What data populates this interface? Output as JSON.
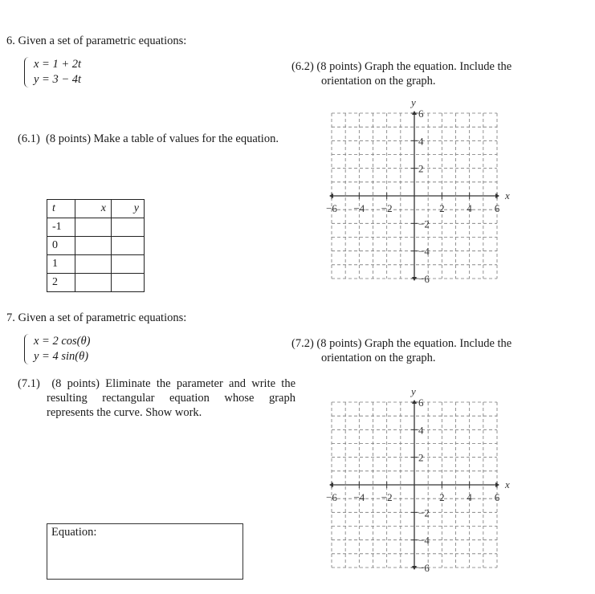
{
  "problem6": {
    "number": "6.",
    "prompt": "Given a set of parametric equations:",
    "equations": [
      "x = 1 + 2t",
      "y = 3 − 4t"
    ],
    "part1": {
      "label": "(6.1)",
      "points": "(8 points)",
      "text": "Make a table of values for the equation.",
      "table": {
        "headers": [
          "t",
          "x",
          "y"
        ],
        "rows": [
          {
            "t": "-1",
            "x": "",
            "y": ""
          },
          {
            "t": "0",
            "x": "",
            "y": ""
          },
          {
            "t": "1",
            "x": "",
            "y": ""
          },
          {
            "t": "2",
            "x": "",
            "y": ""
          }
        ]
      }
    },
    "part2": {
      "label": "(6.2)",
      "points": "(8 points)",
      "text_line1": "Graph the equation. Include the",
      "text_line2": "orientation on the graph."
    }
  },
  "problem7": {
    "number": "7.",
    "prompt": "Given a set of parametric equations:",
    "equations": [
      "x = 2 cos(θ)",
      "y = 4 sin(θ)"
    ],
    "part1": {
      "label": "(7.1)",
      "points": "(8 points)",
      "text": "Eliminate the parameter and write the resulting rectangular equation whose graph represents the curve. Show work.",
      "answer_box_label": "Equation:"
    },
    "part2": {
      "label": "(7.2)",
      "points": "(8 points)",
      "text_line1": "Graph the equation. Include the",
      "text_line2": "orientation on the graph."
    }
  },
  "chart_data": [
    {
      "type": "scatter",
      "title": "",
      "xlabel": "x",
      "ylabel": "y",
      "xlim": [
        -6,
        6
      ],
      "ylim": [
        -6,
        6
      ],
      "grid": true,
      "grid_step": 1,
      "x_tick_labels": [
        "−6",
        "−4",
        "−2",
        "2",
        "4",
        "6"
      ],
      "y_tick_labels": [
        "6",
        "4",
        "2",
        "−2",
        "−4",
        "−6"
      ],
      "x_ticks": [
        -6,
        -4,
        -2,
        2,
        4,
        6
      ],
      "y_ticks": [
        6,
        4,
        2,
        -2,
        -4,
        -6
      ],
      "series": []
    },
    {
      "type": "scatter",
      "title": "",
      "xlabel": "x",
      "ylabel": "y",
      "xlim": [
        -6,
        6
      ],
      "ylim": [
        -6,
        6
      ],
      "grid": true,
      "grid_step": 1,
      "x_tick_labels": [
        "−6",
        "−4",
        "−2",
        "2",
        "4",
        "6"
      ],
      "y_tick_labels": [
        "6",
        "4",
        "2",
        "−2",
        "−4",
        "−6"
      ],
      "x_ticks": [
        -6,
        -4,
        -2,
        2,
        4,
        6
      ],
      "y_ticks": [
        6,
        4,
        2,
        -2,
        -4,
        -6
      ],
      "series": []
    }
  ]
}
